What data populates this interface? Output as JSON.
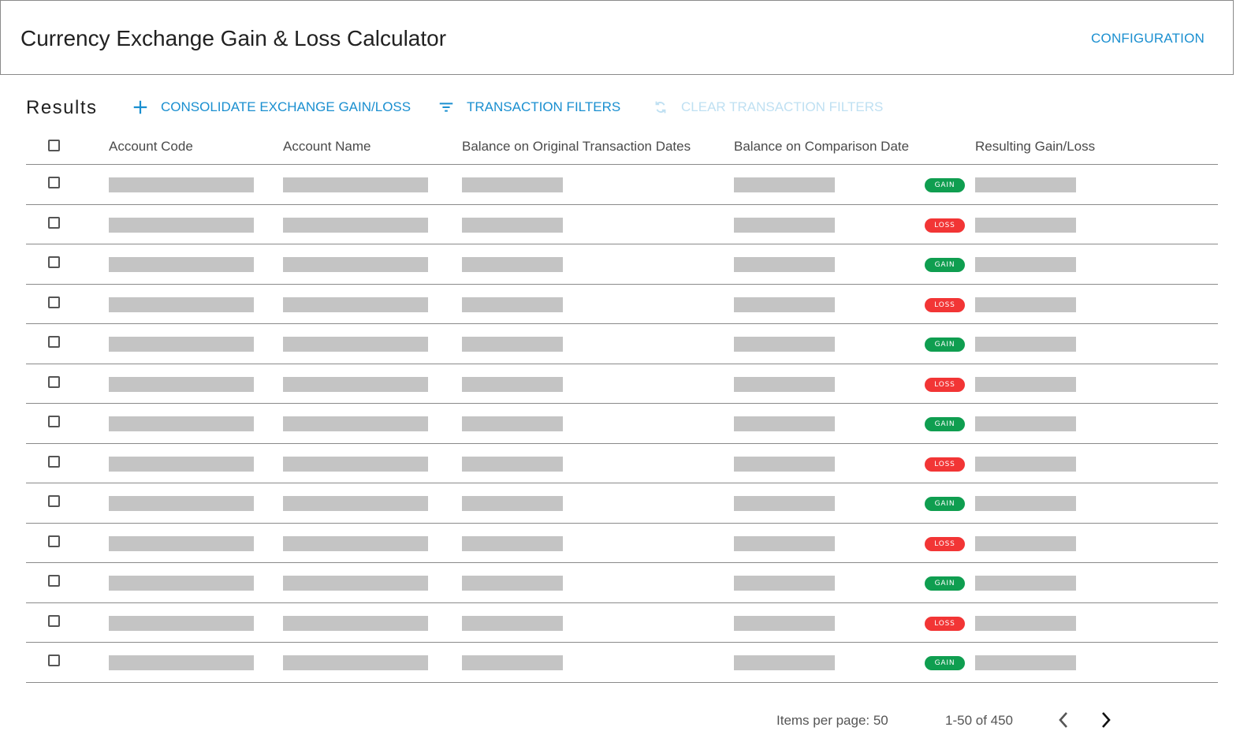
{
  "header": {
    "title": "Currency Exchange Gain & Loss Calculator",
    "config_label": "CONFIGURATION"
  },
  "toolbar": {
    "results_label": "Results",
    "consolidate_label": "CONSOLIDATE EXCHANGE GAIN/LOSS",
    "filters_label": "TRANSACTION FILTERS",
    "clear_label": "CLEAR TRANSACTION FILTERS"
  },
  "table": {
    "columns": [
      "Account Code",
      "Account Name",
      "Balance on Original Transaction Dates",
      "Balance on Comparison Date",
      "Resulting Gain/Loss"
    ],
    "rows": [
      {
        "badge": "GAIN"
      },
      {
        "badge": "LOSS"
      },
      {
        "badge": "GAIN"
      },
      {
        "badge": "LOSS"
      },
      {
        "badge": "GAIN"
      },
      {
        "badge": "LOSS"
      },
      {
        "badge": "GAIN"
      },
      {
        "badge": "LOSS"
      },
      {
        "badge": "GAIN"
      },
      {
        "badge": "LOSS"
      },
      {
        "badge": "GAIN"
      },
      {
        "badge": "LOSS"
      },
      {
        "badge": "GAIN"
      }
    ]
  },
  "paginator": {
    "items_per_page": "Items per page: 50",
    "range": "1-50 of 450"
  },
  "colors": {
    "accent": "#1a8fd0",
    "gain": "#0f9e50",
    "loss": "#f23535",
    "placeholder": "#c4c4c4"
  },
  "icons": {
    "consolidate": "plus-icon",
    "filters": "filter-icon",
    "clear": "refresh-icon",
    "prev": "chevron-left-icon",
    "next": "chevron-right-icon"
  }
}
